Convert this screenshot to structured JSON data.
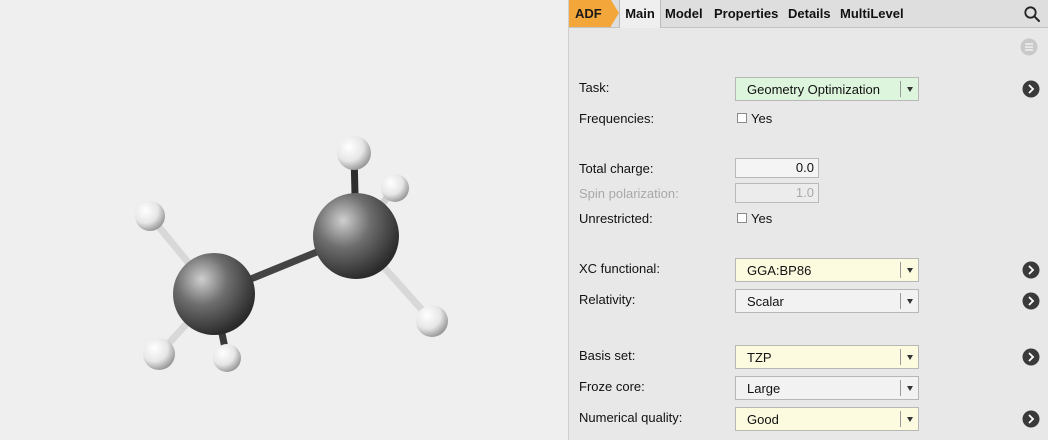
{
  "tabs": {
    "adf": "ADF",
    "main": "Main",
    "others": [
      "Model",
      "Properties",
      "Details",
      "MultiLevel"
    ]
  },
  "icons": {
    "search": "search-icon",
    "menu": "menu-icon",
    "go": "chevron-right-circle-icon"
  },
  "colors": {
    "adf_tab": "#f3a63a",
    "green_field": "#dcf5dc",
    "yellow_field": "#fcfbe0"
  },
  "form": {
    "task": {
      "label": "Task:",
      "value": "Geometry Optimization"
    },
    "frequencies": {
      "label": "Frequencies:",
      "check_label": "Yes",
      "checked": false
    },
    "total_charge": {
      "label": "Total charge:",
      "value": "0.0"
    },
    "spin_polarization": {
      "label": "Spin polarization:",
      "value": "1.0"
    },
    "unrestricted": {
      "label": "Unrestricted:",
      "check_label": "Yes",
      "checked": false
    },
    "xc_functional": {
      "label": "XC functional:",
      "value": "GGA:BP86"
    },
    "relativity": {
      "label": "Relativity:",
      "value": "Scalar"
    },
    "basis_set": {
      "label": "Basis set:",
      "value": "TZP"
    },
    "froze_core": {
      "label": "Froze core:",
      "value": "Large"
    },
    "numerical_quality": {
      "label": "Numerical quality:",
      "value": "Good"
    }
  }
}
